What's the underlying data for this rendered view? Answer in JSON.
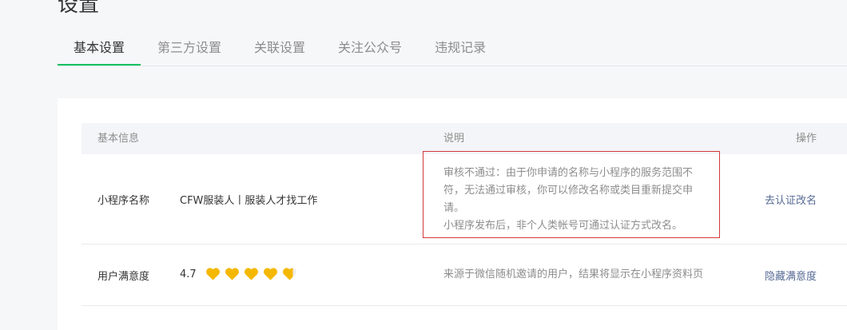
{
  "page": {
    "title": "设置"
  },
  "tabs": [
    {
      "label": "基本设置",
      "active": true
    },
    {
      "label": "第三方设置",
      "active": false
    },
    {
      "label": "关联设置",
      "active": false
    },
    {
      "label": "关注公众号",
      "active": false
    },
    {
      "label": "违规记录",
      "active": false
    }
  ],
  "table": {
    "headers": {
      "info": "基本信息",
      "desc": "说明",
      "op": "操作"
    },
    "rows": [
      {
        "label": "小程序名称",
        "value": "CFW服装人丨服装人才找工作",
        "desc_lines": [
          "审核不通过：由于你申请的名称与小程序的服务范围不",
          "符，无法通过审核，你可以修改名称或类目重新提交申",
          "请。",
          "小程序发布后，非个人类帐号可通过认证方式改名。"
        ],
        "action": "去认证改名"
      },
      {
        "label": "用户满意度",
        "rating": "4.7",
        "rating_value": 4.7,
        "rating_max": 5,
        "desc_lines": [
          "来源于微信随机邀请的用户，结果将显示在小程序资料页"
        ],
        "action": "隐藏满意度"
      }
    ]
  },
  "colors": {
    "accent": "#07c160",
    "link": "#576b95",
    "heart": "#f5b800",
    "highlight_border": "#d33a3a"
  }
}
